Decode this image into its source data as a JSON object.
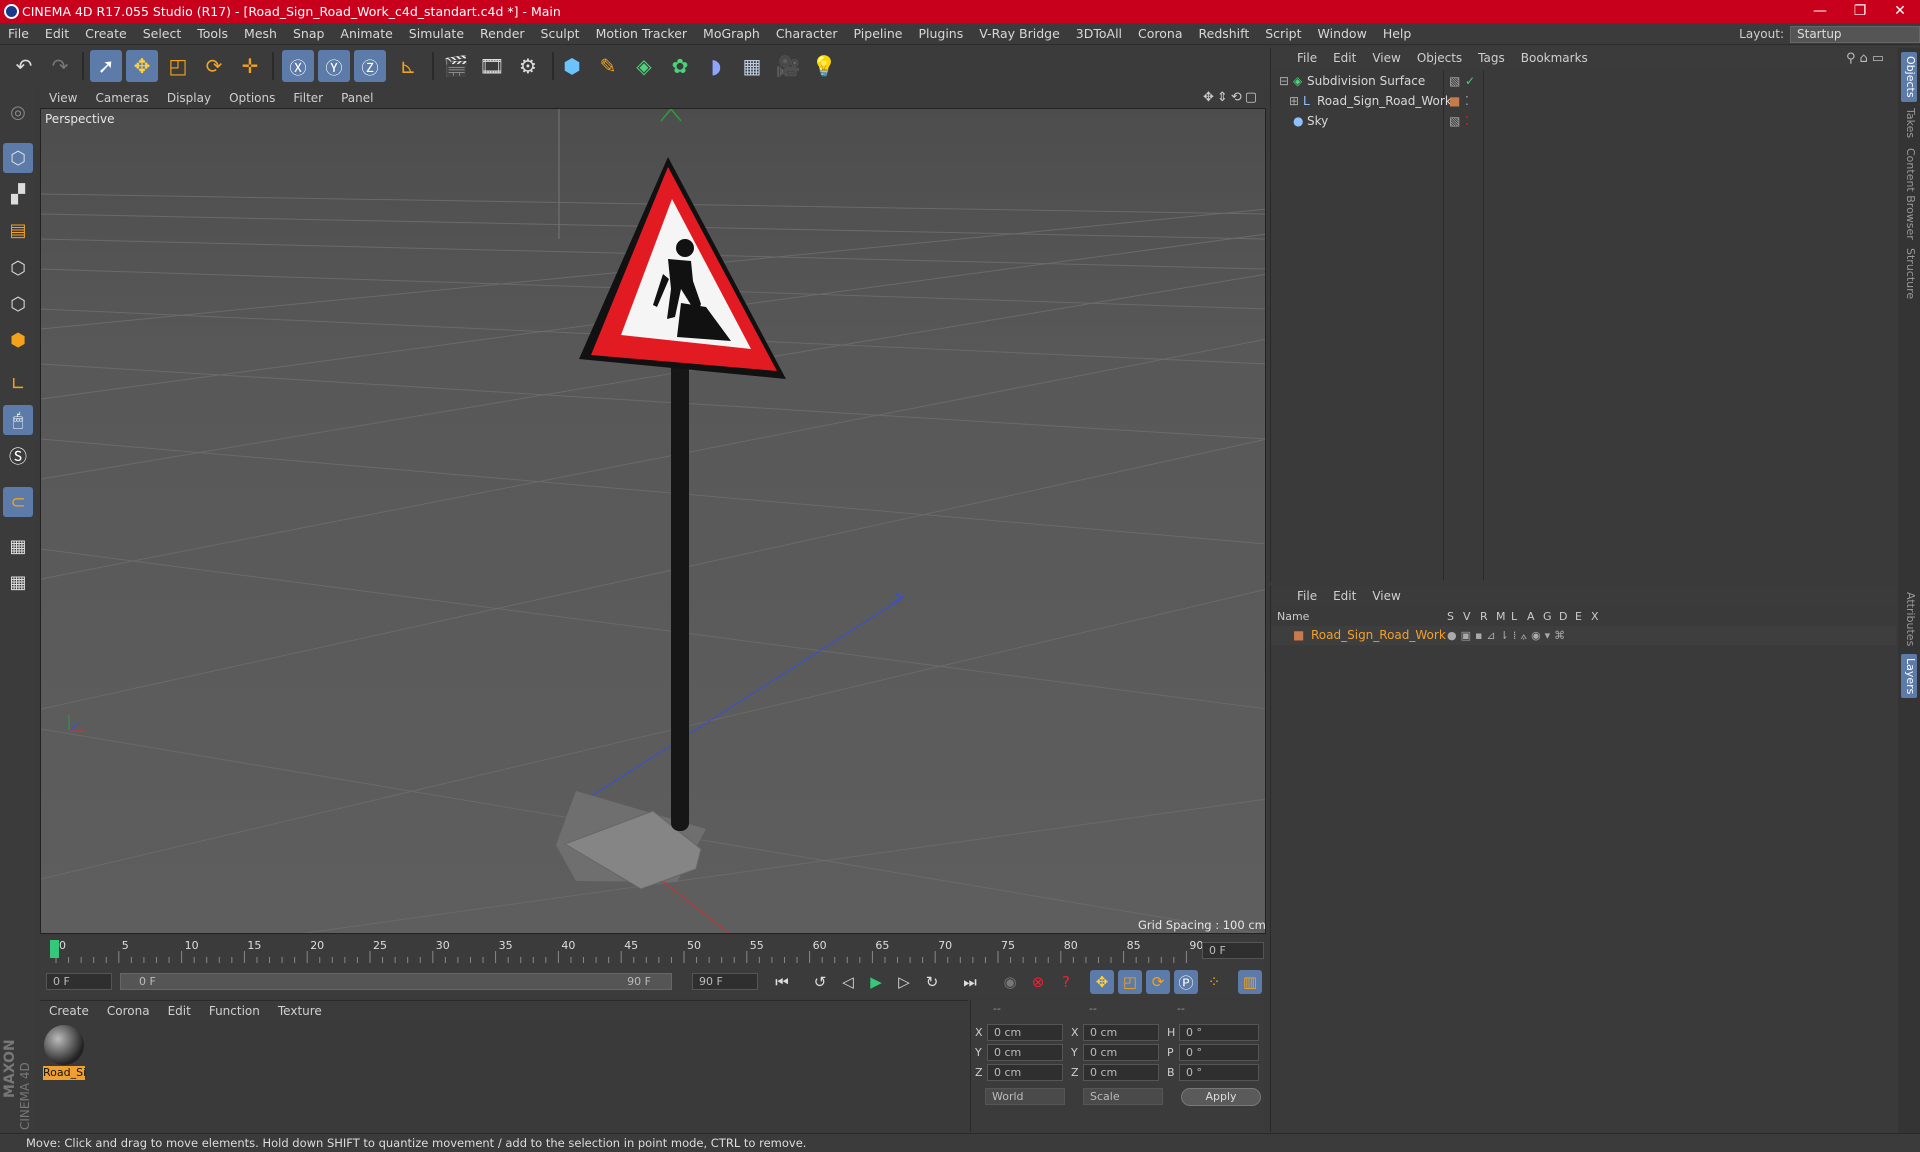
{
  "window": {
    "title": "CINEMA 4D R17.055 Studio (R17) - [Road_Sign_Road_Work_c4d_standart.c4d *] - Main",
    "minimize": "—",
    "maximize": "❐",
    "close": "✕"
  },
  "menubar": {
    "items": [
      "File",
      "Edit",
      "Create",
      "Select",
      "Tools",
      "Mesh",
      "Snap",
      "Animate",
      "Simulate",
      "Render",
      "Sculpt",
      "Motion Tracker",
      "MoGraph",
      "Character",
      "Pipeline",
      "Plugins",
      "V-Ray Bridge",
      "3DToAll",
      "Corona",
      "Redshift",
      "Script",
      "Window",
      "Help"
    ],
    "layout_label": "Layout:",
    "layout_value": "Startup"
  },
  "viewport": {
    "menu": [
      "View",
      "Cameras",
      "Display",
      "Options",
      "Filter",
      "Panel"
    ],
    "label": "Perspective",
    "grid_spacing": "Grid Spacing : 100 cm"
  },
  "timeline": {
    "ticks": [
      "0",
      "5",
      "10",
      "15",
      "20",
      "25",
      "30",
      "35",
      "40",
      "45",
      "50",
      "55",
      "60",
      "65",
      "70",
      "75",
      "80",
      "85",
      "90"
    ],
    "current_frame": "0 F"
  },
  "transport": {
    "start_field": "0 F",
    "range_start": "0 F",
    "range_end": "90 F",
    "end_field": "90 F"
  },
  "material_manager": {
    "menu": [
      "Create",
      "Corona",
      "Edit",
      "Function",
      "Texture"
    ],
    "material_name": "Road_Si"
  },
  "coordinates": {
    "header": [
      "--",
      "--",
      "--"
    ],
    "rows": [
      {
        "a": "X",
        "av": "0 cm",
        "b": "X",
        "bv": "0 cm",
        "c": "H",
        "cv": "0 °"
      },
      {
        "a": "Y",
        "av": "0 cm",
        "b": "Y",
        "bv": "0 cm",
        "c": "P",
        "cv": "0 °"
      },
      {
        "a": "Z",
        "av": "0 cm",
        "b": "Z",
        "bv": "0 cm",
        "c": "B",
        "cv": "0 °"
      }
    ],
    "mode": "World",
    "scale": "Scale",
    "apply": "Apply"
  },
  "object_manager": {
    "menu": [
      "File",
      "Edit",
      "View",
      "Objects",
      "Tags",
      "Bookmarks"
    ],
    "objects": [
      "Subdivision Surface",
      "Road_Sign_Road_Work",
      "Sky"
    ]
  },
  "layer_manager": {
    "menu": [
      "File",
      "Edit",
      "View"
    ],
    "columns": [
      "Name",
      "S",
      "V",
      "R",
      "M",
      "L",
      "A",
      "G",
      "D",
      "E",
      "X"
    ],
    "layer_name": "Road_Sign_Road_Work"
  },
  "right_tabs": [
    "Objects",
    "Takes",
    "Content Browser",
    "Structure",
    "Attributes",
    "Layers"
  ],
  "maxon": {
    "brand": "MAXON",
    "product": "CINEMA 4D"
  },
  "status": "Move: Click and drag to move elements. Hold down SHIFT to quantize movement / add to the selection in point mode, CTRL to remove.",
  "colors": {
    "title_bar": "#c9001c",
    "accent": "#5c7ba8",
    "viewport": "#5a5a5a",
    "layer_name": "#f0a030"
  }
}
